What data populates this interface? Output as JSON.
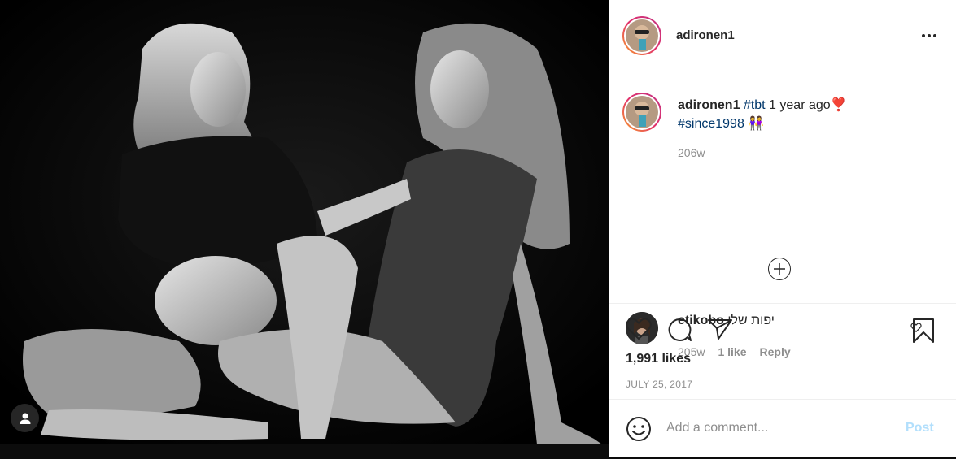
{
  "post": {
    "author": "adironen1",
    "more_icon": "more-horizontal-icon",
    "caption": {
      "username": "adironen1",
      "hashtag1": "#tbt",
      "text": " 1 year ago",
      "heart_emoji": "❣️",
      "hashtag2": "#since1998",
      "people_emoji": "👭",
      "time": "206w"
    },
    "load_more_icon": "plus-circle-icon",
    "comment": {
      "username": "etikobo",
      "text": "יפות שלי",
      "time": "205w",
      "likes": "1 like",
      "reply": "Reply"
    },
    "likes": "1,991 likes",
    "date": "JULY 25, 2017",
    "add_comment": {
      "placeholder": "Add a comment...",
      "post_label": "Post"
    }
  },
  "colors": {
    "link": "#00376b",
    "muted": "#8e8e8e",
    "post_disabled": "#b2dffc"
  }
}
